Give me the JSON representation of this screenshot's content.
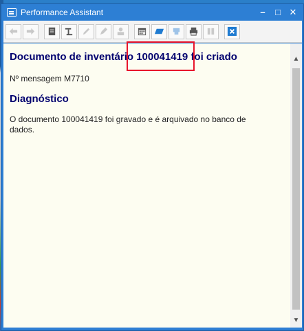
{
  "window": {
    "title": "Performance Assistant",
    "controls": [
      "minimize",
      "maximize",
      "close"
    ]
  },
  "toolbar": {
    "buttons": [
      {
        "name": "back-icon"
      },
      {
        "name": "forward-icon"
      },
      {
        "name": "technical-info-icon"
      },
      {
        "name": "tools-icon"
      },
      {
        "name": "edit-document-icon"
      },
      {
        "name": "highlight-icon"
      },
      {
        "name": "user-icon"
      },
      {
        "name": "calendar-icon"
      },
      {
        "name": "flag-icon"
      },
      {
        "name": "save-icon"
      },
      {
        "name": "print-icon"
      },
      {
        "name": "split-icon"
      },
      {
        "name": "close-doc-icon"
      }
    ]
  },
  "content": {
    "heading": "Documento de inventário 100041419 foi criado",
    "message_number": "Nº mensagem M7710",
    "diagnostic_heading": "Diagnóstico",
    "diagnostic_text": "O documento 100041419 foi gravado e é arquivado no banco de dados."
  },
  "colors": {
    "titlebar": "#2d7fd4",
    "heading": "#00006e",
    "content_bg": "#fdfdf1",
    "highlight_box": "#e8142a"
  }
}
